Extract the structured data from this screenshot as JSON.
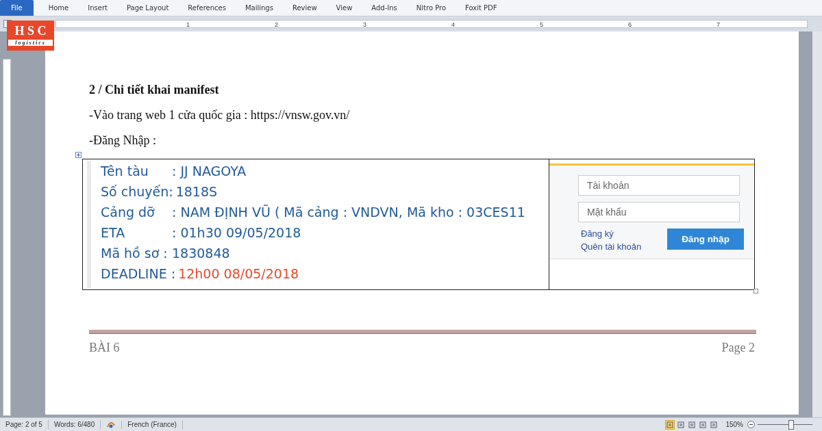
{
  "ribbon": {
    "tabs": [
      {
        "label": "File",
        "selected": true
      },
      {
        "label": "Home",
        "selected": false
      },
      {
        "label": "Insert",
        "selected": false
      },
      {
        "label": "Page Layout",
        "selected": false
      },
      {
        "label": "References",
        "selected": false
      },
      {
        "label": "Mailings",
        "selected": false
      },
      {
        "label": "Review",
        "selected": false
      },
      {
        "label": "View",
        "selected": false
      },
      {
        "label": "Add-Ins",
        "selected": false
      },
      {
        "label": "Nitro Pro",
        "selected": false
      },
      {
        "label": "Foxit PDF",
        "selected": false
      }
    ]
  },
  "logo": {
    "name": "H S C",
    "tagline": "logistics"
  },
  "ruler": {
    "numbers": [
      "1",
      "2",
      "3",
      "4",
      "5",
      "6",
      "7"
    ]
  },
  "document": {
    "heading": "2 / Chi tiết khai manifest",
    "paragraphs": [
      "-Vào trang web 1 cửa quốc gia : https://vnsw.gov.vn/",
      "-Đăng Nhập :"
    ],
    "info_lines": [
      {
        "label": "Tên tàu",
        "value": ": JJ NAGOYA",
        "highlight": false
      },
      {
        "label": "Số chuyến:",
        "value": "1818S",
        "highlight": false
      },
      {
        "label": "Cảng dỡ",
        "value": ":  NAM ĐỊNH VŨ ( Mã cảng : VNDVN, Mã kho : 03CES11",
        "highlight": false
      },
      {
        "label": "ETA",
        "value": ": 01h30 09/05/2018",
        "highlight": false
      },
      {
        "label": "Mã hồ sơ :",
        "value": "1830848",
        "highlight": false
      },
      {
        "label": "DEADLINE :",
        "value": "12h00 08/05/2018",
        "highlight": true
      }
    ],
    "login": {
      "username_placeholder": "Tài khoản",
      "password_placeholder": "Mật khẩu",
      "links": [
        "Đăng ký",
        "Quên tài khoản"
      ],
      "button": "Đăng nhập"
    },
    "footer": {
      "left": "BÀI 6",
      "right": "Page 2"
    }
  },
  "status_bar": {
    "page": "Page: 2 of 5",
    "words": "Words: 6/480",
    "language": "French (France)",
    "zoom": "150%",
    "views": [
      {
        "selected": true
      },
      {
        "selected": false
      },
      {
        "selected": false
      },
      {
        "selected": false
      },
      {
        "selected": false
      }
    ],
    "zoom_slider": {
      "level": 0.6
    }
  }
}
